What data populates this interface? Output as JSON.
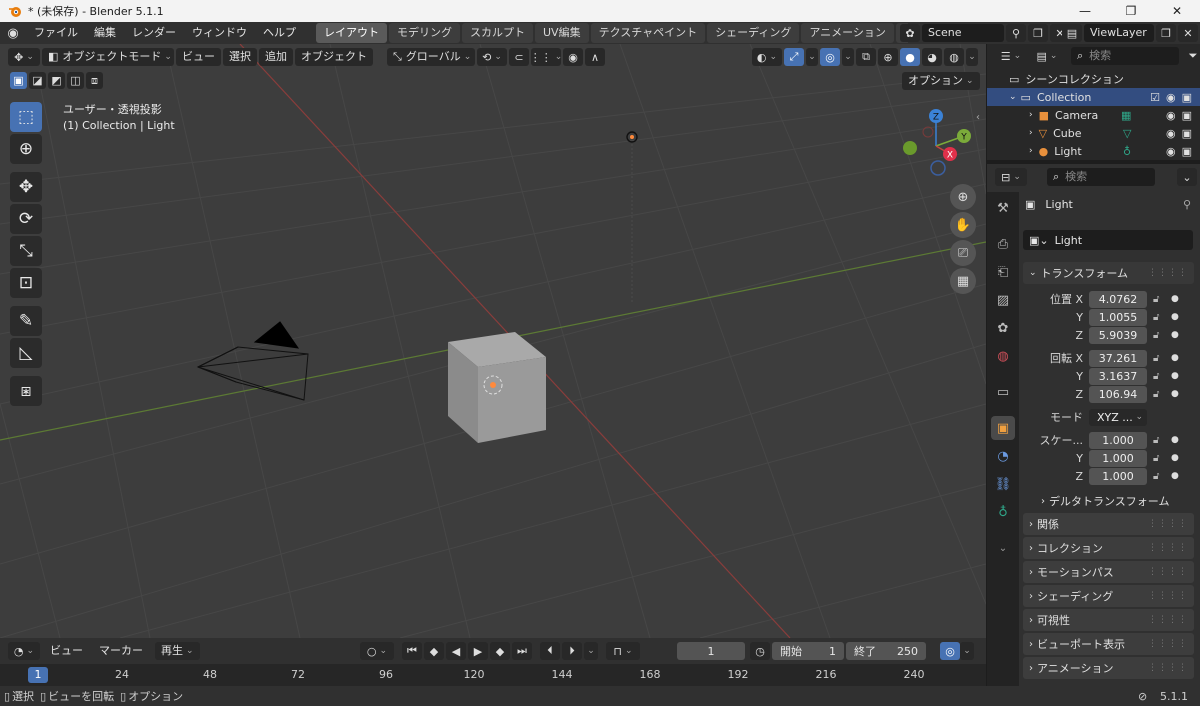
{
  "window": {
    "title": "* (未保存) - Blender 5.1.1",
    "controls": [
      "—",
      "❐",
      "✕"
    ]
  },
  "topbar": {
    "menus": [
      "ファイル",
      "編集",
      "レンダー",
      "ウィンドウ",
      "ヘルプ"
    ],
    "workspaces": [
      "レイアウト",
      "モデリング",
      "スカルプト",
      "UV編集",
      "テクスチャペイント",
      "シェーディング",
      "アニメーション",
      "レ"
    ],
    "scene": "Scene",
    "view_layer": "ViewLayer"
  },
  "viewport": {
    "mode": "オブジェクトモード",
    "menus": [
      "ビュー",
      "選択",
      "追加",
      "オブジェクト"
    ],
    "transform_orientation": "グローバル",
    "options_label": "オプション",
    "view_name": "ユーザー・透視投影",
    "collection_info": "(1) Collection | Light",
    "gizmo": {
      "x": "X",
      "y": "Y",
      "z": "Z"
    },
    "colors": {
      "bg": "#3d3d3d",
      "x_axis": "#c4453f",
      "y_axis": "#7bab3a",
      "z_axis": "#3b82d6",
      "accent": "#4772b3"
    }
  },
  "outliner": {
    "search_placeholder": "検索",
    "root": "シーンコレクション",
    "collection": "Collection",
    "items": [
      {
        "name": "Camera",
        "icon": "camera-icon"
      },
      {
        "name": "Cube",
        "icon": "mesh-icon"
      },
      {
        "name": "Light",
        "icon": "light-icon"
      }
    ]
  },
  "properties": {
    "search_placeholder": "検索",
    "object_name": "Light",
    "object_field": "Light",
    "transform_title": "トランスフォーム",
    "location_label": "位置 X",
    "rotation_label": "回転 X",
    "mode_label": "モード",
    "mode_value": "XYZ ...",
    "scale_label": "スケー...",
    "y_label": "Y",
    "z_label": "Z",
    "location": [
      "4.0762",
      "1.0055",
      "5.9039"
    ],
    "rotation": [
      "37.261",
      "3.1637",
      "106.94"
    ],
    "scale": [
      "1.000",
      "1.000",
      "1.000"
    ],
    "delta_transform": "デルタトランスフォーム",
    "panels": [
      "関係",
      "コレクション",
      "モーションパス",
      "シェーディング",
      "可視性",
      "ビューポート表示",
      "アニメーション"
    ]
  },
  "timeline": {
    "menus": [
      "ビュー",
      "マーカー"
    ],
    "playback": "再生",
    "current_frame": "1",
    "start_label": "開始",
    "start": "1",
    "end_label": "終了",
    "end": "250",
    "ticks": [
      "1",
      "24",
      "48",
      "72",
      "96",
      "120",
      "144",
      "168",
      "192",
      "216",
      "240"
    ]
  },
  "statusbar": {
    "select": "選択",
    "rotate": "ビューを回転",
    "options": "オプション",
    "version": "5.1.1"
  }
}
